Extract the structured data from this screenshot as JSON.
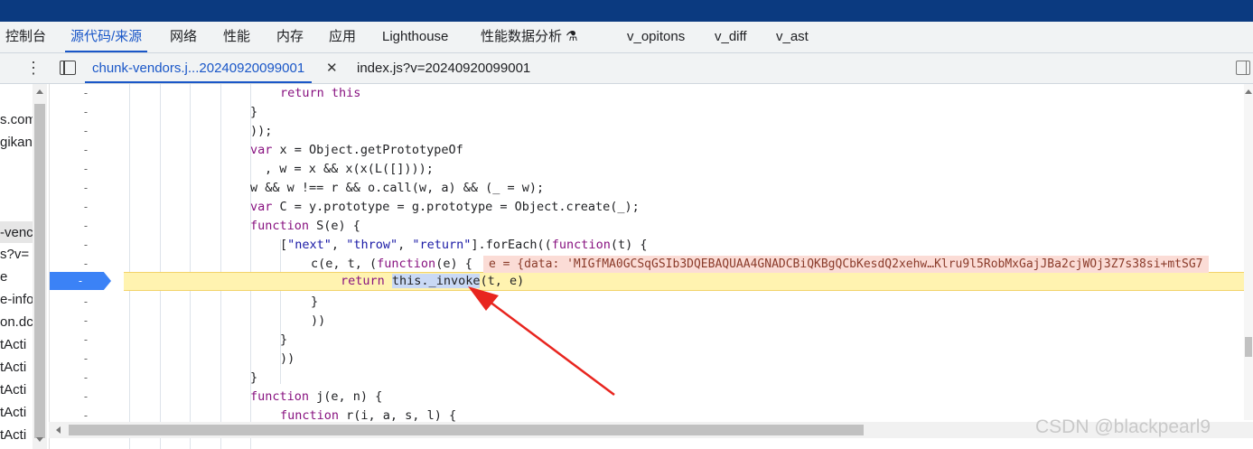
{
  "tabs": [
    "控制台",
    "源代码/来源",
    "网络",
    "性能",
    "内存",
    "应用",
    "Lighthouse",
    "性能数据分析 ⚗",
    "v_opitons",
    "v_diff",
    "v_ast"
  ],
  "files": {
    "active": "chunk-vendors.j...20240920099001",
    "second": "index.js?v=20240920099001"
  },
  "nav_items": [
    "s.com",
    "gikan",
    "-venc",
    "s?v=",
    "e",
    "e-info",
    "on.dc",
    "tActi",
    "tActi",
    "tActi",
    "tActi",
    "tActi"
  ],
  "gutter_mark": "-",
  "code": {
    "l1_kw": "return",
    "l1_rest": " this",
    "l2": "}",
    "l3": "));",
    "l4_kw": "var",
    "l4_rest": " x = Object.getPrototypeOf",
    "l5": ", w = x && x(x(L([])));",
    "l6": "w && w !== r && o.call(w, a) && (_ = w);",
    "l7_kw": "var",
    "l7_rest": " C = y.prototype = g.prototype = Object.create(_);",
    "l8_kw": "function",
    "l8_rest": " S(e) {",
    "l9_a": "[",
    "l9_s1": "\"next\"",
    "l9_b": ", ",
    "l9_s2": "\"throw\"",
    "l9_c": ", ",
    "l9_s3": "\"return\"",
    "l9_d": "].forEach((",
    "l9_kw": "function",
    "l9_e": "(t) {",
    "l10_a": "c(e, t, (",
    "l10_kw": "function",
    "l10_b": "(e) {",
    "l10_inline": "e = {data: 'MIGfMA0GCSqGSIb3DQEBAQUAA4GNADCBiQKBgQCbKesdQ2xehw…Klru9l5RobMxGajJBa2cjWOj3Z7s38si+mtSG7",
    "l11_kw": "return",
    "l11_sel": "this._invoke",
    "l11_rest": "(t, e)",
    "l12": "}",
    "l13": "))",
    "l14": "}",
    "l15": "))",
    "l16": "}",
    "l17_kw": "function",
    "l17_rest": " j(e, n) {",
    "l18_kw": "function",
    "l18_rest": " r(i, a, s, l) {"
  },
  "watermark": "CSDN @blackpearl9"
}
